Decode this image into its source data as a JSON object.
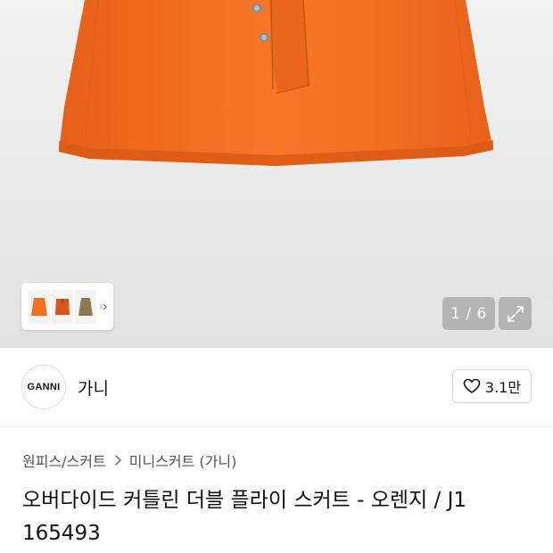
{
  "gallery": {
    "counter": "1 / 6",
    "thumbnails": [
      "orange-skirt-thumb",
      "orange-jacket-thumb",
      "khaki-skirt-thumb"
    ],
    "colors": {
      "product": "#f26e22",
      "product_shadow": "#d95a15",
      "button": "#9a9a9a"
    }
  },
  "brand": {
    "logo_text": "GANNI",
    "name": "가니",
    "like_count": "3.1만"
  },
  "breadcrumb": {
    "items": [
      "원피스/스커트",
      "미니스커트 (가니)"
    ]
  },
  "product": {
    "title_line1": "오버다이드 커틀린 더블 플라이 스커트 - 오렌지 / J1",
    "title_line2": "165493"
  }
}
